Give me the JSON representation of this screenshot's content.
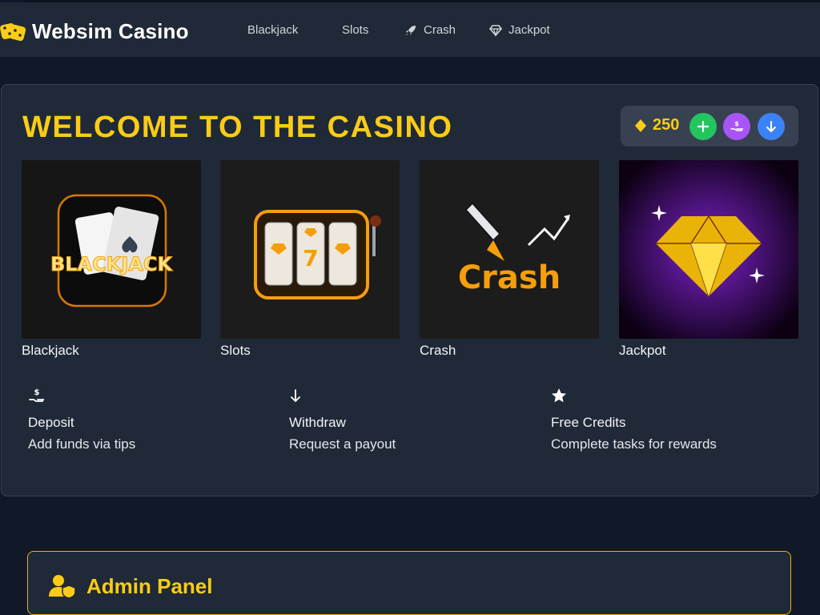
{
  "brand": {
    "name": "Websim Casino",
    "icon": "dice-icon"
  },
  "nav": [
    {
      "label": "Blackjack",
      "icon": ""
    },
    {
      "label": "Slots",
      "icon": ""
    },
    {
      "label": "Crash",
      "icon": "rocket-icon"
    },
    {
      "label": "Jackpot",
      "icon": "gem-icon"
    }
  ],
  "hero": {
    "title": "WELCOME TO THE CASINO"
  },
  "wallet": {
    "balance": "250",
    "icon": "gem-icon",
    "buttons": [
      {
        "name": "add-credits-button",
        "icon": "plus-icon",
        "color": "#22c55e"
      },
      {
        "name": "deposit-button",
        "icon": "hand-dollar-icon",
        "color": "#a855f7"
      },
      {
        "name": "withdraw-button",
        "icon": "arrow-down-icon",
        "color": "#3b82f6"
      }
    ]
  },
  "games": [
    {
      "label": "Blackjack",
      "art_text": "BLACKJACK"
    },
    {
      "label": "Slots",
      "art_text": "7"
    },
    {
      "label": "Crash",
      "art_text": "Crash"
    },
    {
      "label": "Jackpot",
      "art_text": ""
    }
  ],
  "features": [
    {
      "title": "Deposit",
      "desc": "Add funds via tips",
      "icon": "hand-dollar-icon"
    },
    {
      "title": "Withdraw",
      "desc": "Request a payout",
      "icon": "arrow-down-icon"
    },
    {
      "title": "Free Credits",
      "desc": "Complete tasks for rewards",
      "icon": "star-icon"
    }
  ],
  "admin": {
    "title": "Admin Panel",
    "icon": "user-shield-icon"
  },
  "colors": {
    "accent": "#facc15",
    "bg": "#111827",
    "panel": "#1f2937"
  }
}
